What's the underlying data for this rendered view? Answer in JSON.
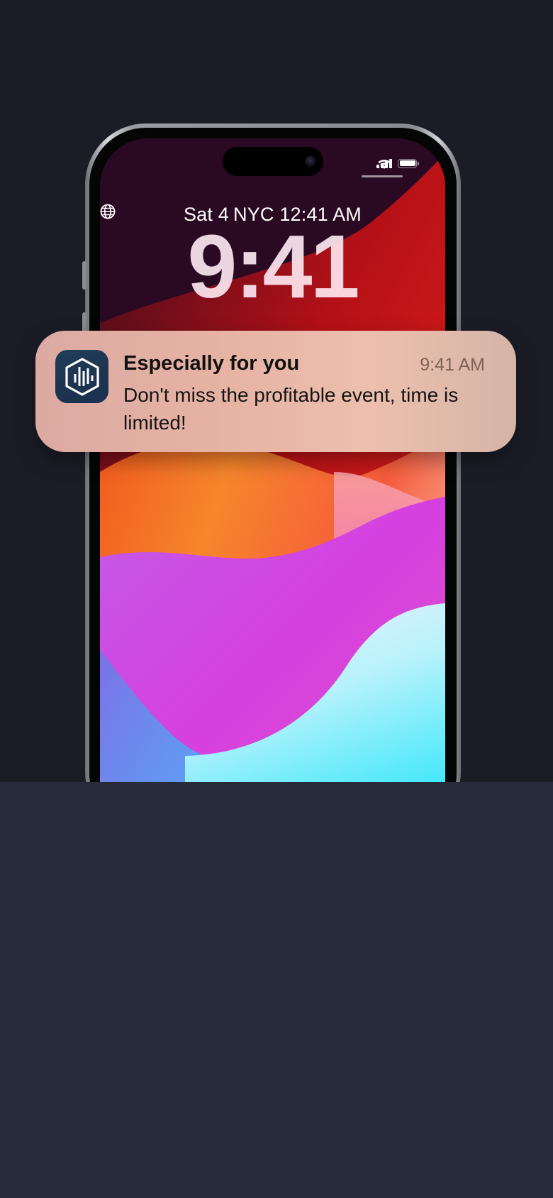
{
  "lockscreen": {
    "date": "Sat 4",
    "world_clock": "NYC 12:41 AM",
    "time": "9:41"
  },
  "status_bar": {
    "signal": "signal-icon",
    "wifi": "wifi-icon",
    "battery": "battery-icon"
  },
  "notification": {
    "title": "Especially for you",
    "time": "9:41 AM",
    "body": "Don't miss the profitable event, time is limited!",
    "app_icon": "building-chart-app-icon"
  },
  "colors": {
    "page_background": "#272a39",
    "top_background": "#1b1c26",
    "notification_bg": "#e7b3a4",
    "app_icon_bg": "#1e3550"
  }
}
